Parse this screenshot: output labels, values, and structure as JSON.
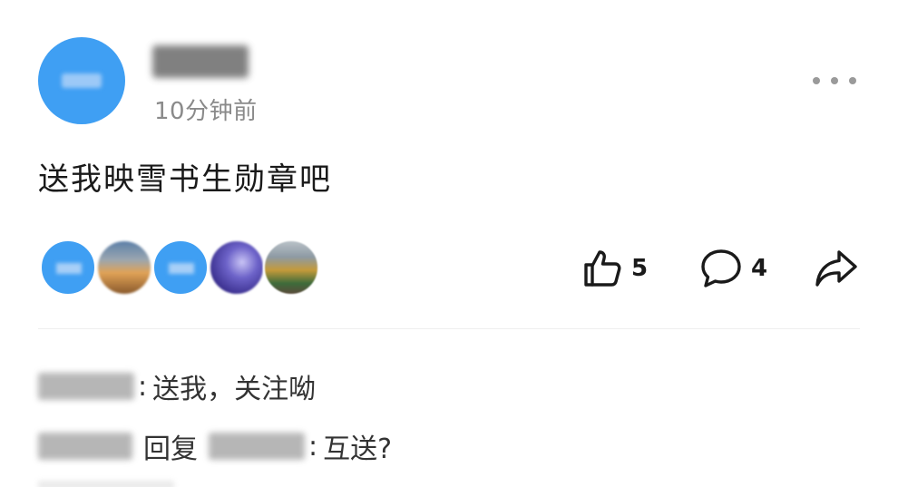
{
  "post": {
    "time": "10分钟前",
    "text": "送我映雪书生勋章吧"
  },
  "actions": {
    "like_count": "5",
    "comment_count": "4"
  },
  "comments": [
    {
      "text": "送我，关注呦"
    },
    {
      "reply_word": "回复",
      "text": "互送?"
    }
  ],
  "colors": {
    "avatar_blue": "#3f9ff3",
    "meta_gray": "#8a8a8a",
    "icon_dark": "#1a1a1a"
  },
  "icons": {
    "more": "more-dots-icon",
    "like": "thumbs-up-icon",
    "comment": "comment-bubble-icon",
    "share": "share-arrow-icon"
  }
}
